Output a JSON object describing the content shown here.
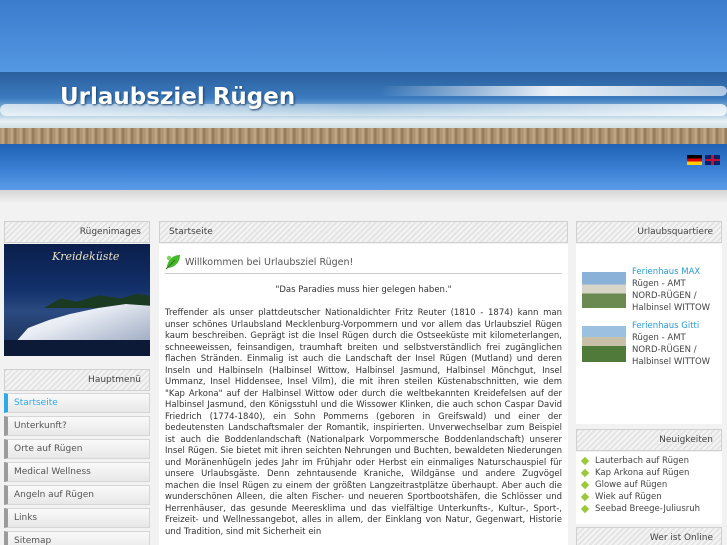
{
  "header": {
    "site_title": "Urlaubsziel Rügen",
    "languages": [
      "de",
      "en"
    ]
  },
  "left": {
    "images_heading": "Rügenimages",
    "image_caption": "Kreideküste",
    "menu_heading": "Hauptmenü",
    "menu_items": [
      {
        "label": "Startseite",
        "active": true
      },
      {
        "label": "Unterkunft?"
      },
      {
        "label": "Orte auf Rügen"
      },
      {
        "label": "Medical Wellness"
      },
      {
        "label": "Angeln auf Rügen"
      },
      {
        "label": "Links"
      },
      {
        "label": "Sitemap"
      }
    ]
  },
  "center": {
    "breadcrumb": "Startseite",
    "welcome_title": "Willkommen bei Urlaubsziel Rügen!",
    "quote": "\"Das Paradies muss hier gelegen haben.\"",
    "body": "Treffender als unser plattdeutscher Nationaldichter Fritz Reuter (1810 - 1874) kann man unser schönes Urlaubsland Mecklenburg-Vorpommern und vor allem das Urlaubsziel Rügen kaum beschreiben. Geprägt ist die Insel Rügen durch die Ostseeküste mit kilometerlangen, schneeweissen, feinsandigen, traumhaft breiten und selbstverständlich frei zugänglichen flachen Stränden. Einmalig ist auch die Landschaft der Insel Rügen (Mutland) und deren Inseln und Halbinseln (Halbinsel Wittow, Halbinsel Jasmund, Halbinsel Mönchgut, Insel Ummanz, Insel Hiddensee, Insel Vilm), die mit ihren steilen Küstenabschnitten, wie dem \"Kap Arkona\" auf der Halbinsel Wittow oder durch die weltbekannten Kreidefelsen auf der Halbinsel Jasmund, den Königsstuhl und die Wissower Klinken, die auch schon Caspar David Friedrich (1774-1840), ein Sohn Pommerns (geboren in Greifswald) und einer der bedeutensten Landschaftsmaler der Romantik, inspirierten. Unverwechselbar zum Beispiel ist auch die Boddenlandschaft (Nationalpark Vorpommersche Boddenlandschaft) unserer Insel Rügen. Sie bietet mit ihren seichten Nehrungen und Buchten, bewaldeten Niederungen und Moränenhügeln jedes Jahr im Frühjahr oder Herbst ein einmaliges Naturschauspiel für unsere Urlaubsgäste. Denn zehntausende Kraniche, Wildgänse und andere Zugvögel machen die Insel Rügen zu einem der größten Langzeitrastplätze überhaupt. Aber auch die wunderschönen Alleen, die alten Fischer- und neueren Sportbootshäfen, die Schlösser und Herrenhäuser, das gesunde Meeresklima und das vielfältige Unterkunfts-, Kultur-, Sport-, Freizeit- und Wellnessangebot, alles in allem, der Einklang von Natur, Gegenwart, Historie und Tradition, sind mit Sicherheit ein"
  },
  "right": {
    "quarters_heading": "Urlaubsquartiere",
    "quarters": [
      {
        "title": "Ferienhaus MAX",
        "line1": "Rügen - AMT",
        "line2": "NORD-RÜGEN /",
        "line3": "Halbinsel WITTOW"
      },
      {
        "title": "Ferienhaus Gitti",
        "line1": "Rügen - AMT",
        "line2": "NORD-RÜGEN /",
        "line3": "Halbinsel WITTOW"
      }
    ],
    "news_heading": "Neuigkeiten",
    "news": [
      "Lauterbach auf Rügen",
      "Kap Arkona auf Rügen",
      "Glowe auf Rügen",
      "Wiek auf Rügen",
      "Seebad Breege-Juliusruh"
    ],
    "online_heading": "Wer ist Online"
  }
}
